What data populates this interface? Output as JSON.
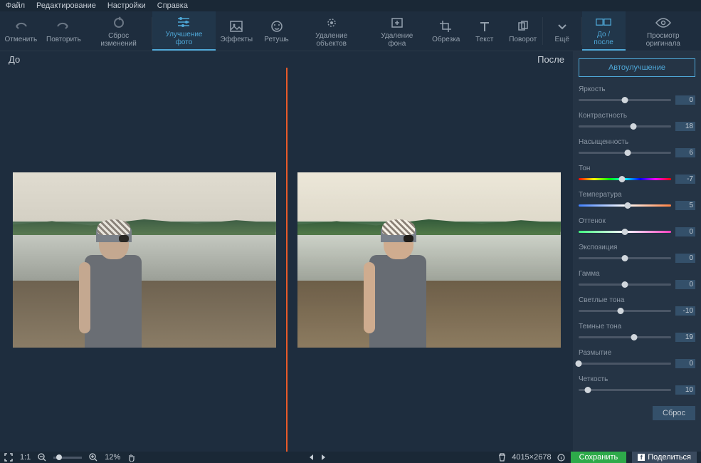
{
  "menubar": [
    "Файл",
    "Редактирование",
    "Настройки",
    "Справка"
  ],
  "toolbar": {
    "undo": "Отменить",
    "redo": "Повторить",
    "reset": "Сброс изменений",
    "enhance": "Улучшение фото",
    "effects": "Эффекты",
    "retouch": "Ретушь",
    "removeObjects": "Удаление объектов",
    "removeBg": "Удаление фона",
    "crop": "Обрезка",
    "text": "Текст",
    "rotate": "Поворот",
    "more": "Ещё",
    "beforeAfter": "До / после",
    "viewOriginal": "Просмотр оригинала"
  },
  "compare": {
    "before": "До",
    "after": "После"
  },
  "sidebar": {
    "auto": "Автоулучшение",
    "reset": "Сброс",
    "sliders": [
      {
        "label": "Яркость",
        "value": 0,
        "pos": 50,
        "type": "plain"
      },
      {
        "label": "Контрастность",
        "value": 18,
        "pos": 59,
        "type": "plain"
      },
      {
        "label": "Насыщенность",
        "value": 6,
        "pos": 53,
        "type": "plain"
      },
      {
        "label": "Тон",
        "value": -7,
        "pos": 47,
        "type": "hue"
      },
      {
        "label": "Температура",
        "value": 5,
        "pos": 53,
        "type": "temp"
      },
      {
        "label": "Оттенок",
        "value": 0,
        "pos": 50,
        "type": "tint"
      },
      {
        "label": "Экспозиция",
        "value": 0,
        "pos": 50,
        "type": "plain"
      },
      {
        "label": "Гамма",
        "value": 0,
        "pos": 50,
        "type": "plain"
      },
      {
        "label": "Светлые тона",
        "value": -10,
        "pos": 45,
        "type": "plain"
      },
      {
        "label": "Темные тона",
        "value": 19,
        "pos": 60,
        "type": "plain"
      },
      {
        "label": "Размытие",
        "value": 0,
        "pos": 0,
        "type": "plain"
      },
      {
        "label": "Четкость",
        "value": 10,
        "pos": 10,
        "type": "plain"
      }
    ]
  },
  "statusbar": {
    "scale": "1:1",
    "zoom": "12%",
    "dimensions": "4015×2678",
    "save": "Сохранить",
    "share": "Поделиться"
  }
}
